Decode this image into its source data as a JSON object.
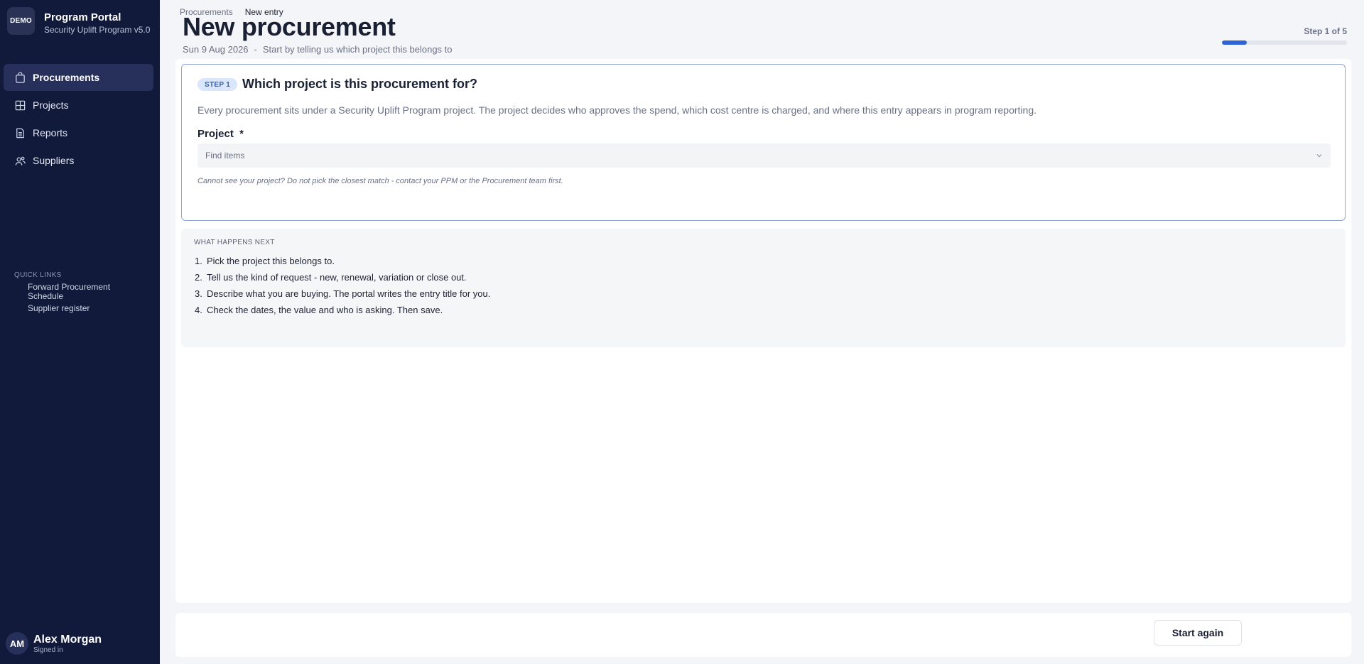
{
  "brand": {
    "logo_text": "DEMO",
    "title": "Program Portal",
    "subtitle": "Security Uplift Program v5.0"
  },
  "sidebar": {
    "items": [
      {
        "label": "Procurements",
        "icon": "bag-icon",
        "active": true
      },
      {
        "label": "Projects",
        "icon": "layout-icon",
        "active": false
      },
      {
        "label": "Reports",
        "icon": "document-icon",
        "active": false
      },
      {
        "label": "Suppliers",
        "icon": "users-icon",
        "active": false
      }
    ],
    "quick_links": {
      "title": "QUICK LINKS",
      "links": [
        "Forward Procurement Schedule",
        "Supplier register"
      ]
    },
    "user": {
      "initials": "AM",
      "name": "Alex Morgan",
      "status": "Signed in"
    }
  },
  "breadcrumb": {
    "parent": "Procurements",
    "current": "New entry"
  },
  "header": {
    "title": "New procurement",
    "date": "Sun 9 Aug 2026",
    "separator": "-",
    "subtitle": "Start by telling us which project this belongs to",
    "step_count": "Step 1 of 5",
    "progress": 0.2
  },
  "step_card": {
    "badge": "STEP 1",
    "title": "Which project is this procurement for?",
    "description": "Every procurement sits under a Security Uplift Program project. The project decides who approves the spend, which cost centre is charged, and where this entry appears in program reporting.",
    "field_label": "Project  *",
    "select_placeholder": "Find items",
    "hint": "Cannot see your project? Do not pick the closest match - contact your PPM or the Procurement team first."
  },
  "next_steps": {
    "title": "WHAT HAPPENS NEXT",
    "items": [
      {
        "num": "1.",
        "text": "Pick the project this belongs to."
      },
      {
        "num": "2.",
        "text": "Tell us the kind of request - new, renewal, variation or close out."
      },
      {
        "num": "3.",
        "text": "Describe what you are buying. The portal writes the entry title for you."
      },
      {
        "num": "4.",
        "text": "Check the dates, the value and who is asking. Then save."
      }
    ]
  },
  "footer": {
    "start_again_label": "Start again"
  },
  "colors": {
    "sidebar_bg": "#111a3a",
    "accent": "#2e63d8",
    "card_border": "#8fa6d6"
  }
}
